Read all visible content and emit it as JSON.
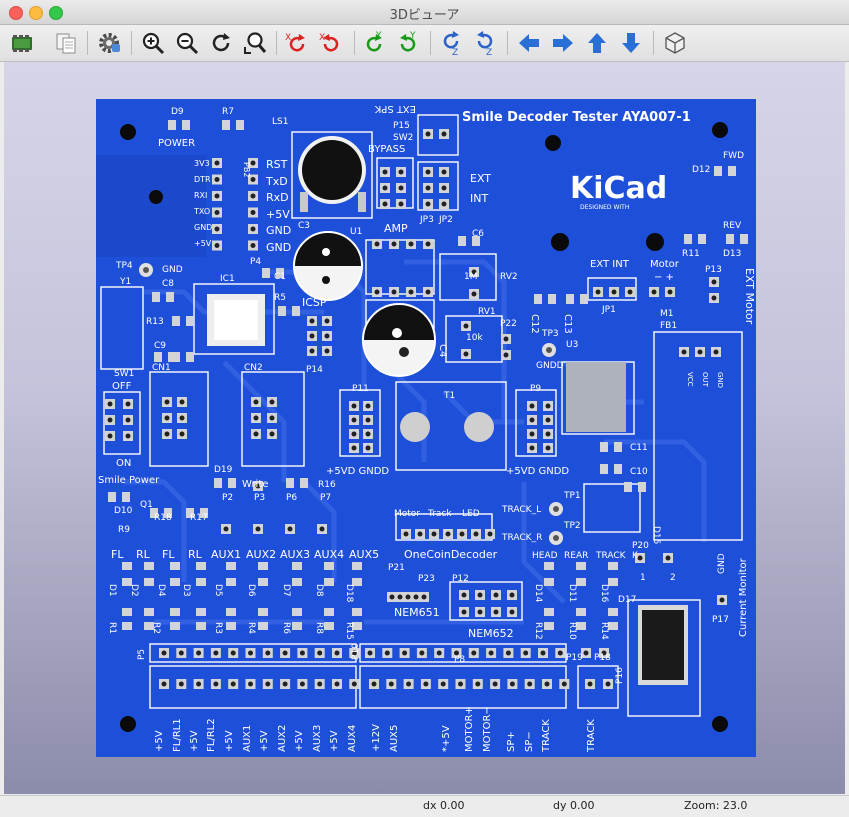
{
  "window": {
    "title": "3Dビューア"
  },
  "toolbar": {
    "buttons": [
      {
        "name": "reload-board-button",
        "icon": "reload-3d-icon"
      },
      {
        "name": "copy-image-button",
        "icon": "copy-icon"
      },
      {
        "name": "settings-button",
        "icon": "gear-icon"
      },
      {
        "name": "zoom-in-button",
        "icon": "zoom-in-icon"
      },
      {
        "name": "zoom-out-button",
        "icon": "zoom-out-icon"
      },
      {
        "name": "refresh-button",
        "icon": "refresh-icon"
      },
      {
        "name": "zoom-fit-button",
        "icon": "zoom-fit-icon"
      },
      {
        "name": "rotate-x-cw-button",
        "icon": "rotate-x-icon",
        "label": "X"
      },
      {
        "name": "rotate-x-ccw-button",
        "icon": "rotate-x-icon",
        "label": "X"
      },
      {
        "name": "rotate-y-cw-button",
        "icon": "rotate-y-icon",
        "label": "Y"
      },
      {
        "name": "rotate-y-ccw-button",
        "icon": "rotate-y-icon",
        "label": "Y"
      },
      {
        "name": "rotate-z-cw-button",
        "icon": "rotate-z-icon",
        "label": "Z"
      },
      {
        "name": "rotate-z-ccw-button",
        "icon": "rotate-z-icon",
        "label": "Z"
      },
      {
        "name": "move-left-button",
        "icon": "arrow-left-icon"
      },
      {
        "name": "move-right-button",
        "icon": "arrow-right-icon"
      },
      {
        "name": "move-up-button",
        "icon": "arrow-up-icon"
      },
      {
        "name": "move-down-button",
        "icon": "arrow-down-icon"
      },
      {
        "name": "ortho-view-button",
        "icon": "cube-icon"
      }
    ]
  },
  "board": {
    "title": "Smile Decoder Tester AYA007-1",
    "kicad_logo": "KiCad",
    "kicad_tagline": "DESIGNED WITH",
    "labels": [
      {
        "id": "D9",
        "t": "D9"
      },
      {
        "id": "R7",
        "t": "R7"
      },
      {
        "id": "POWER",
        "t": "POWER"
      },
      {
        "id": "LS1",
        "t": "LS1"
      },
      {
        "id": "EXTSPK",
        "t": "EXT SPK"
      },
      {
        "id": "P15",
        "t": "P15"
      },
      {
        "id": "SW2",
        "t": "SW2"
      },
      {
        "id": "BYPASS",
        "t": "BYPASS"
      },
      {
        "id": "EXT",
        "t": "EXT"
      },
      {
        "id": "INT",
        "t": "INT"
      },
      {
        "id": "JP3",
        "t": "JP3"
      },
      {
        "id": "JP2",
        "t": "JP2"
      },
      {
        "id": "FWD",
        "t": "FWD"
      },
      {
        "id": "D12",
        "t": "D12"
      },
      {
        "id": "REV",
        "t": "REV"
      },
      {
        "id": "R11",
        "t": "R11"
      },
      {
        "id": "D13",
        "t": "D13"
      },
      {
        "id": "V3V3",
        "t": "3V3"
      },
      {
        "id": "DTR",
        "t": "DTR"
      },
      {
        "id": "RXI",
        "t": "RXI"
      },
      {
        "id": "TXO",
        "t": "TXO"
      },
      {
        "id": "GNDa",
        "t": "GND"
      },
      {
        "id": "P5V",
        "t": "+5V"
      },
      {
        "id": "PB2",
        "t": "PB2"
      },
      {
        "id": "RST",
        "t": "RST"
      },
      {
        "id": "TxD",
        "t": "TxD"
      },
      {
        "id": "RxD",
        "t": "RxD"
      },
      {
        "id": "P5Vb",
        "t": "+5V"
      },
      {
        "id": "GNDb",
        "t": "GND"
      },
      {
        "id": "GNDc",
        "t": "GND"
      },
      {
        "id": "C3",
        "t": "C3"
      },
      {
        "id": "U1",
        "t": "U1"
      },
      {
        "id": "AMP",
        "t": "AMP"
      },
      {
        "id": "C6",
        "t": "C6"
      },
      {
        "id": "TP4",
        "t": "TP4"
      },
      {
        "id": "GNDd",
        "t": "GND"
      },
      {
        "id": "Y1",
        "t": "Y1"
      },
      {
        "id": "IC1",
        "t": "IC1"
      },
      {
        "id": "C1",
        "t": "C1"
      },
      {
        "id": "C8",
        "t": "C8"
      },
      {
        "id": "R5",
        "t": "R5"
      },
      {
        "id": "R13",
        "t": "R13"
      },
      {
        "id": "ICSP",
        "t": "ICSP"
      },
      {
        "id": "P4",
        "t": "P4"
      },
      {
        "id": "C9",
        "t": "C9"
      },
      {
        "id": "P14",
        "t": "P14"
      },
      {
        "id": "M1",
        "t": "1M"
      },
      {
        "id": "RV2",
        "t": "RV2"
      },
      {
        "id": "RV1",
        "t": "RV1"
      },
      {
        "id": "K10",
        "t": "10k"
      },
      {
        "id": "C4",
        "t": "C4"
      },
      {
        "id": "P22",
        "t": "P22"
      },
      {
        "id": "C12",
        "t": "C12"
      },
      {
        "id": "C13",
        "t": "C13"
      },
      {
        "id": "TP3",
        "t": "TP3"
      },
      {
        "id": "GNDD",
        "t": "GNDD"
      },
      {
        "id": "U3",
        "t": "U3"
      },
      {
        "id": "EXTINT",
        "t": "EXT INT"
      },
      {
        "id": "JP1",
        "t": "JP1"
      },
      {
        "id": "MotorL",
        "t": "Motor"
      },
      {
        "id": "MotorPM",
        "t": "−  +"
      },
      {
        "id": "P13",
        "t": "P13"
      },
      {
        "id": "EXTMotor",
        "t": "EXT Motor"
      },
      {
        "id": "M1b",
        "t": "M1"
      },
      {
        "id": "FB1",
        "t": "FB1"
      },
      {
        "id": "VCC",
        "t": "VCC"
      },
      {
        "id": "OUT",
        "t": "OUT"
      },
      {
        "id": "GNDe",
        "t": "GND"
      },
      {
        "id": "SW1",
        "t": "SW1"
      },
      {
        "id": "OFF",
        "t": "OFF"
      },
      {
        "id": "ON",
        "t": "ON"
      },
      {
        "id": "CN1",
        "t": "CN1"
      },
      {
        "id": "CN2",
        "t": "CN2"
      },
      {
        "id": "P11",
        "t": "P11"
      },
      {
        "id": "P9",
        "t": "P9"
      },
      {
        "id": "T1",
        "t": "T1"
      },
      {
        "id": "V5VD1",
        "t": "+5VD GNDD"
      },
      {
        "id": "V5VD2",
        "t": "+5VD GNDD"
      },
      {
        "id": "C11",
        "t": "C11"
      },
      {
        "id": "C10",
        "t": "C10"
      },
      {
        "id": "SmilePower",
        "t": "Smile Power"
      },
      {
        "id": "D19",
        "t": "D19"
      },
      {
        "id": "Write",
        "t": "Write"
      },
      {
        "id": "R16",
        "t": "R16"
      },
      {
        "id": "Q1",
        "t": "Q1"
      },
      {
        "id": "D10",
        "t": "D10"
      },
      {
        "id": "R9",
        "t": "R9"
      },
      {
        "id": "R18",
        "t": "R18"
      },
      {
        "id": "R17",
        "t": "R17"
      },
      {
        "id": "P2",
        "t": "P2"
      },
      {
        "id": "P3",
        "t": "P3"
      },
      {
        "id": "P6",
        "t": "P6"
      },
      {
        "id": "P7",
        "t": "P7"
      },
      {
        "id": "Motor2",
        "t": "Motor"
      },
      {
        "id": "Track2",
        "t": "Track"
      },
      {
        "id": "LED",
        "t": "LED"
      },
      {
        "id": "TP1",
        "t": "TP1"
      },
      {
        "id": "TRACKL",
        "t": "TRACK_L"
      },
      {
        "id": "TP2",
        "t": "TP2"
      },
      {
        "id": "TRACKR",
        "t": "TRACK_R"
      },
      {
        "id": "D15",
        "t": "D15"
      },
      {
        "id": "P21",
        "t": "P21"
      },
      {
        "id": "OneCoin",
        "t": "OneCoinDecoder"
      },
      {
        "id": "FL1",
        "t": "FL"
      },
      {
        "id": "RL1",
        "t": "RL"
      },
      {
        "id": "FL2",
        "t": "FL"
      },
      {
        "id": "RL2",
        "t": "RL"
      },
      {
        "id": "AUX1",
        "t": "AUX1"
      },
      {
        "id": "AUX2",
        "t": "AUX2"
      },
      {
        "id": "AUX3",
        "t": "AUX3"
      },
      {
        "id": "AUX4",
        "t": "AUX4"
      },
      {
        "id": "AUX5",
        "t": "AUX5"
      },
      {
        "id": "HEAD",
        "t": "HEAD"
      },
      {
        "id": "REAR",
        "t": "REAR"
      },
      {
        "id": "TRACKa",
        "t": "TRACK"
      },
      {
        "id": "K",
        "t": "K"
      },
      {
        "id": "P20",
        "t": "P20"
      },
      {
        "id": "N1",
        "t": "1"
      },
      {
        "id": "N2",
        "t": "2"
      },
      {
        "id": "D1",
        "t": "D1"
      },
      {
        "id": "D2",
        "t": "D2"
      },
      {
        "id": "D4",
        "t": "D4"
      },
      {
        "id": "D3",
        "t": "D3"
      },
      {
        "id": "D5",
        "t": "D5"
      },
      {
        "id": "D6",
        "t": "D6"
      },
      {
        "id": "D7",
        "t": "D7"
      },
      {
        "id": "D8",
        "t": "D8"
      },
      {
        "id": "D18",
        "t": "D18"
      },
      {
        "id": "D14",
        "t": "D14"
      },
      {
        "id": "D11",
        "t": "D11"
      },
      {
        "id": "D16",
        "t": "D16"
      },
      {
        "id": "D17",
        "t": "D17"
      },
      {
        "id": "P23",
        "t": "P23"
      },
      {
        "id": "P12",
        "t": "P12"
      },
      {
        "id": "NEM651",
        "t": "NEM651"
      },
      {
        "id": "NEM652",
        "t": "NEM652"
      },
      {
        "id": "R1",
        "t": "R1"
      },
      {
        "id": "R2",
        "t": "R2"
      },
      {
        "id": "R3",
        "t": "R3"
      },
      {
        "id": "R4",
        "t": "R4"
      },
      {
        "id": "R6",
        "t": "R6"
      },
      {
        "id": "R8",
        "t": "R8"
      },
      {
        "id": "R15",
        "t": "R15"
      },
      {
        "id": "R12",
        "t": "R12"
      },
      {
        "id": "R10",
        "t": "R10"
      },
      {
        "id": "R14",
        "t": "R14"
      },
      {
        "id": "GNDf",
        "t": "GND"
      },
      {
        "id": "P17",
        "t": "P17"
      },
      {
        "id": "CurMon",
        "t": "Current Monitor"
      },
      {
        "id": "P5",
        "t": "P5"
      },
      {
        "id": "P10",
        "t": "P10"
      },
      {
        "id": "P8",
        "t": "P8"
      },
      {
        "id": "P19",
        "t": "P19"
      },
      {
        "id": "P18",
        "t": "P18"
      },
      {
        "id": "P16",
        "t": "P16"
      },
      {
        "id": "B1",
        "t": "+5V"
      },
      {
        "id": "B2",
        "t": "FL/RL1"
      },
      {
        "id": "B3",
        "t": "+5V"
      },
      {
        "id": "B4",
        "t": "FL/RL2"
      },
      {
        "id": "B5",
        "t": "+5V"
      },
      {
        "id": "B6",
        "t": "AUX1"
      },
      {
        "id": "B7",
        "t": "+5V"
      },
      {
        "id": "B8",
        "t": "AUX2"
      },
      {
        "id": "B9",
        "t": "+5V"
      },
      {
        "id": "B10",
        "t": "AUX3"
      },
      {
        "id": "B11",
        "t": "+5V"
      },
      {
        "id": "B12",
        "t": "AUX4"
      },
      {
        "id": "B13",
        "t": "+12V"
      },
      {
        "id": "B14",
        "t": "AUX5"
      },
      {
        "id": "B15",
        "t": "*+5V"
      },
      {
        "id": "B16",
        "t": "MOTOR+"
      },
      {
        "id": "B17",
        "t": "MOTOR−"
      },
      {
        "id": "B18",
        "t": "SP+"
      },
      {
        "id": "B19",
        "t": "SP−"
      },
      {
        "id": "B20",
        "t": "TRACK"
      },
      {
        "id": "B21",
        "t": "TRACK"
      }
    ]
  },
  "status": {
    "dx": "dx 0.00",
    "dy": "dy 0.00",
    "zoom": "Zoom: 23.0"
  },
  "colors": {
    "pcb": "#1e4fd8",
    "silk": "#ffffff",
    "pad": "#d3d4d7",
    "accent": "#2a6fd6"
  }
}
